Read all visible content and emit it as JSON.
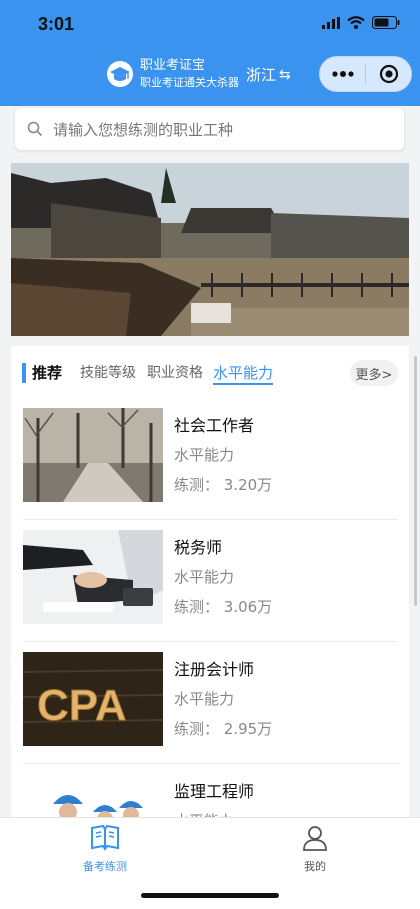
{
  "status_bar": {
    "time": "3:01"
  },
  "header": {
    "app_name": "职业考证宝",
    "slogan": "职业考证通关大杀器",
    "region": "浙江",
    "region_icon": "swap-icon",
    "brand_color": "#3a93ef"
  },
  "search": {
    "placeholder": "请输入您想练测的职业工种"
  },
  "tabs": {
    "recommend": "推荐",
    "items": [
      "技能等级",
      "职业资格",
      "水平能力"
    ],
    "active": "水平能力",
    "more": "更多>"
  },
  "list": [
    {
      "title": "社会工作者",
      "category": "水平能力",
      "count": "练测： 3.20万"
    },
    {
      "title": "税务师",
      "category": "水平能力",
      "count": "练测： 3.06万"
    },
    {
      "title": "注册会计师",
      "category": "水平能力",
      "count": "练测： 2.95万",
      "image_text": "CPA"
    },
    {
      "title": "监理工程师",
      "category": "水平能力",
      "count": ""
    }
  ],
  "bottom_nav": [
    {
      "label": "备考练测",
      "icon": "open-book-icon",
      "active": true
    },
    {
      "label": "我的",
      "icon": "user-icon",
      "active": false
    }
  ]
}
